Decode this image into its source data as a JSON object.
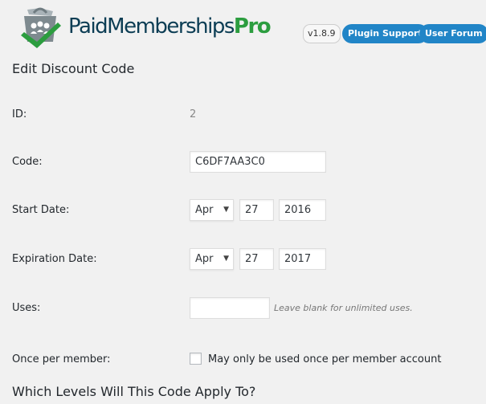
{
  "header": {
    "logo_parts": [
      "Paid",
      "Memberships",
      "Pro"
    ],
    "version": "v1.8.9",
    "support_label": "Plugin Support",
    "forum_label": "User Forum"
  },
  "page": {
    "title": "Edit Discount Code"
  },
  "form": {
    "id": {
      "label": "ID:",
      "value": "2"
    },
    "code": {
      "label": "Code:",
      "value": "C6DF7AA3C0"
    },
    "start_date": {
      "label": "Start Date:",
      "month": "Apr",
      "day": "27",
      "year": "2016"
    },
    "expiration_date": {
      "label": "Expiration Date:",
      "month": "Apr",
      "day": "27",
      "year": "2017"
    },
    "uses": {
      "label": "Uses:",
      "value": "",
      "hint": "Leave blank for unlimited uses."
    },
    "once_per_member": {
      "label": "Once per member:",
      "checked": false,
      "checkbox_label": "May only be used once per member account"
    }
  },
  "levels_section": {
    "title": "Which Levels Will This Code Apply To?"
  },
  "colors": {
    "accent": "#2185c7",
    "brand_dark": "#0c3d54",
    "brand_green": "#2c9d3f"
  }
}
